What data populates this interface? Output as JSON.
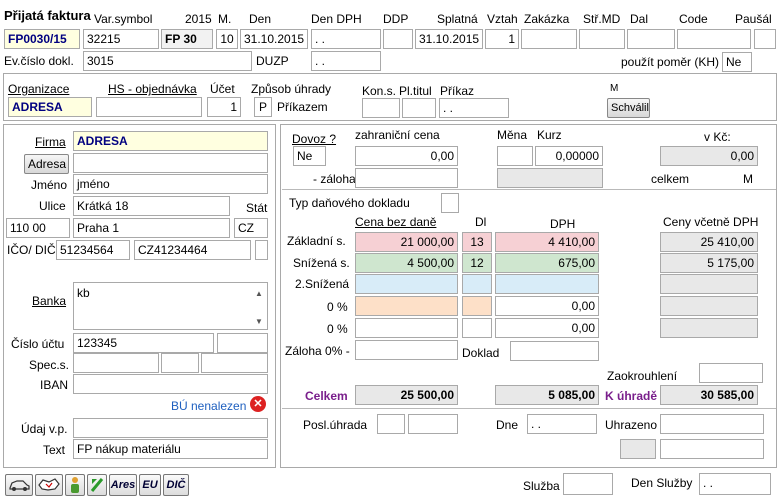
{
  "header": {
    "title": "Přijatá faktura",
    "varsymbol_label": "Var.symbol",
    "year_label": "2015",
    "m_label": "M.",
    "den_label": "Den",
    "den_dph_label": "Den DPH",
    "ddp_label": "DDP",
    "splatna_label": "Splatná",
    "vztah_label": "Vztah",
    "zakazka_label": "Zakázka",
    "strmd_label": "Stř.MD",
    "dal_label": "Dal",
    "code_label": "Code",
    "pausal_label": "Paušál",
    "doc_number": "FP0030/15",
    "varsymbol": "32215",
    "series": "FP 30",
    "month": "10",
    "date": "31.10.2015",
    "den_dph": " . .",
    "ddp": "",
    "splatna": "31.10.2015",
    "vztah": "1",
    "zakazka": "",
    "strmd": "",
    "dal": "",
    "code": "",
    "pausal": "",
    "evcislo_label": "Ev.číslo dokl.",
    "evcislo": "3015",
    "duzp_label": "DUZP",
    "duzp": " . .",
    "pomer_label": "použít poměr (KH)",
    "pomer": "Ne"
  },
  "org": {
    "organizace_label": "Organizace",
    "organizace": "ADRESA",
    "hs_label": "HS - objednávka",
    "hs": "",
    "ucet_label": "Účet",
    "ucet": "1",
    "zpusob_label": "Způsob úhrady",
    "zpusob_code": "P",
    "zpusob_text": "Příkazem",
    "kons_label": "Kon.s.",
    "pltitul_label": "Pl.titul",
    "prikaz_label": "Příkaz",
    "prikaz": " . .",
    "m_label": "M",
    "schvalil_button": "Schválil"
  },
  "left": {
    "firma_label": "Firma",
    "firma": "ADRESA",
    "adresa_button": "Adresa",
    "firma2": "",
    "jmeno_label": "Jméno",
    "jmeno": "jméno",
    "ulice_label": "Ulice",
    "ulice": "Krátká 18",
    "stat_label": "Stát",
    "psc": "110 00",
    "mesto": "Praha 1",
    "stat": "CZ",
    "ico_label": "IČO/ DIČ",
    "ico": "51234564",
    "dic": "CZ41234464",
    "banka_label": "Banka",
    "banka": "kb",
    "cislo_uctu_label": "Číslo účtu",
    "cislo_uctu": "123345",
    "spec_label": "Spec.s.",
    "iban_label": "IBAN",
    "bu_text": "BÚ nenalezen",
    "udaj_label": "Údaj v.p.",
    "udaj": "",
    "text_label": "Text",
    "text": "FP nákup materiálu"
  },
  "right": {
    "dovoz_label": "Dovoz ?",
    "dovoz": "Ne",
    "zahranicni_label": "zahraniční cena",
    "zahranicni": "0,00",
    "mena_label": "Měna",
    "kurz_label": "Kurz",
    "mena": "",
    "kurz": "0,00000",
    "vkc_label": "v Kč:",
    "vkc": "0,00",
    "zaloha_label": "- záloha",
    "celkem_small_label": "celkem",
    "m_label": "M",
    "typ_label": "Typ daňového dokladu",
    "cena_bez_label": "Cena bez daně",
    "dl_label": "Dl",
    "dph_label": "DPH",
    "ceny_vcetne_label": "Ceny včetně DPH",
    "rows": [
      {
        "label": "Základní s.",
        "base": "21 000,00",
        "rate": "13",
        "vat": "4 410,00",
        "total": "25 410,00"
      },
      {
        "label": "Snížená s.",
        "base": "4 500,00",
        "rate": "12",
        "vat": "675,00",
        "total": "5 175,00"
      },
      {
        "label": "2.Snížená",
        "base": "",
        "rate": "",
        "vat": "",
        "total": ""
      },
      {
        "label": "0 %",
        "base": "",
        "rate": "",
        "vat": "0,00",
        "total": ""
      },
      {
        "label": "0 %",
        "base": "",
        "rate": "",
        "vat": "0,00",
        "total": ""
      }
    ],
    "zaloha0_label": "Záloha 0% -",
    "doklad_label": "Doklad",
    "zaokrouhleni_label": "Zaokrouhlení",
    "celkem_label": "Celkem",
    "celkem_base": "25 500,00",
    "celkem_vat": "5 085,00",
    "k_uhrade_label": "K úhradě",
    "k_uhrade": "30 585,00",
    "posl_label": "Posl.úhrada",
    "dne_label": "Dne",
    "dne": " . .",
    "uhrazeno_label": "Uhrazeno"
  },
  "footer": {
    "icons": [
      "car-icon",
      "map-icon",
      "person-icon",
      "refresh-icon"
    ],
    "ares_button": "Ares",
    "eu_button": "EU",
    "dic_button": "DIČ",
    "sluzba_label": "Služba",
    "den_sluzby_label": "Den Služby",
    "den_sluzby": " . ."
  },
  "colors": {
    "accent_blue": "#000080",
    "purple": "#7a1f8c",
    "link_blue": "#1e5fbf",
    "error_red": "#d22"
  }
}
